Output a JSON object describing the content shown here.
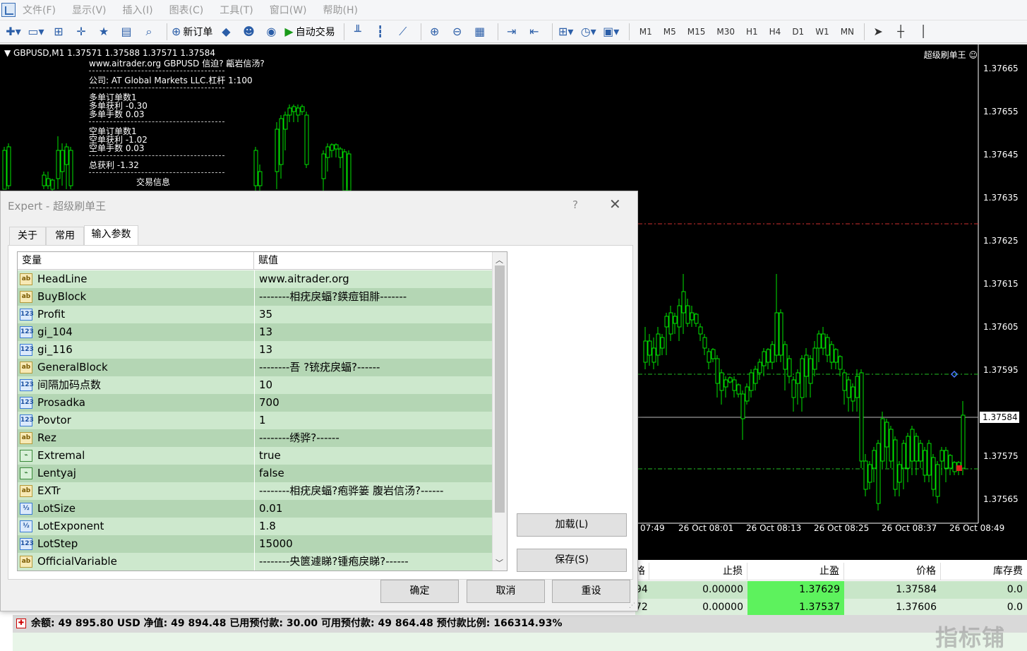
{
  "menu": [
    "文件(F)",
    "显示(V)",
    "插入(I)",
    "图表(C)",
    "工具(T)",
    "窗口(W)",
    "帮助(H)"
  ],
  "toolbar": {
    "new_order": "新订单",
    "auto_trade": "自动交易",
    "timeframes": [
      "M1",
      "M5",
      "M15",
      "M30",
      "H1",
      "H4",
      "D1",
      "W1",
      "MN"
    ]
  },
  "chart": {
    "header": "GBPUSD,M1  1.37571 1.37588 1.37571 1.37584",
    "ea_name": "超级刷单王 ☺",
    "info": {
      "site": "www.aitrader.org GBPUSD   信迫?  甂岩信汤?",
      "company": "公司: AT Global Markets LLC.杠杆 1:100",
      "buy_count": "多单订单数1",
      "buy_profit": "多单获利 -0.30",
      "buy_lots": "多单手数 0.03",
      "sell_count": "空单订单数1",
      "sell_profit": "空单获利 -1.02",
      "sell_lots": "空单手数 0.03",
      "total": "总获利 -1.32",
      "footer": "交易信息"
    },
    "prices": [
      "1.37665",
      "1.37655",
      "1.37645",
      "1.37635",
      "1.37625",
      "1.37615",
      "1.37605",
      "1.37595",
      "1.37585",
      "1.37575",
      "1.37565"
    ],
    "current_price": "1.37584",
    "times": [
      "07:49",
      "26 Oct 08:01",
      "26 Oct 08:13",
      "26 Oct 08:25",
      "26 Oct 08:37",
      "26 Oct 08:49"
    ]
  },
  "dialog": {
    "title": "Expert - 超级刷单王",
    "help": "?",
    "tabs": [
      "关于",
      "常用",
      "输入参数"
    ],
    "col_var": "变量",
    "col_val": "赋值",
    "rows": [
      {
        "type": "ab",
        "name": "HeadLine",
        "value": "www.aitrader.org"
      },
      {
        "type": "ab",
        "name": "BuyBlock",
        "value": "--------相疣戾蝠?鍈痘钼腓-------"
      },
      {
        "type": "123",
        "name": "Profit",
        "value": "35"
      },
      {
        "type": "123",
        "name": "gi_104",
        "value": "13"
      },
      {
        "type": "123",
        "name": "gi_116",
        "value": "13"
      },
      {
        "type": "ab",
        "name": "GeneralBlock",
        "value": "--------吾    ?铳疣戾蝠?------"
      },
      {
        "type": "123",
        "name": "间隔加码点数",
        "value": "10"
      },
      {
        "type": "123",
        "name": "Prosadka",
        "value": "700"
      },
      {
        "type": "123",
        "name": "Povtor",
        "value": "1"
      },
      {
        "type": "ab",
        "name": "Rez",
        "value": "--------绣骅?------"
      },
      {
        "type": "bool",
        "name": "Extremal",
        "value": "true"
      },
      {
        "type": "bool",
        "name": "Lentyaj",
        "value": "false"
      },
      {
        "type": "ab",
        "name": "EXTr",
        "value": "--------相疣戾蝠?疱骅篓 腹岩信汤?------"
      },
      {
        "type": "v2",
        "name": "LotSize",
        "value": "0.01"
      },
      {
        "type": "v2",
        "name": "LotExponent",
        "value": "1.8"
      },
      {
        "type": "123",
        "name": "LotStep",
        "value": "15000"
      },
      {
        "type": "ab",
        "name": "OfficialVariable",
        "value": "--------央篋遽睇?锺疱戾睇?------"
      }
    ],
    "load": "加载(L)",
    "save": "保存(S)",
    "ok": "确定",
    "cancel": "取消",
    "reset": "重设"
  },
  "terminal": {
    "headers": [
      "格",
      "止损",
      "止盈",
      "价格",
      "库存费"
    ],
    "rows": [
      {
        "price_frag": "94",
        "sl": "0.00000",
        "tp": "1.37629",
        "price": "1.37584",
        "swap": "0.0"
      },
      {
        "price_frag": "72",
        "sl": "0.00000",
        "tp": "1.37537",
        "price": "1.37606",
        "swap": "0.0"
      }
    ],
    "balance": "余额: 49 895.80 USD  净值: 49 894.48  已用预付款: 30.00  可用预付款: 49 864.48  预付款比例: 166314.93%"
  },
  "watermark": "指标铺",
  "colors": {
    "bull": "#00e400",
    "chart_bg": "#000000",
    "grid_row_a": "#c8e6c8",
    "grid_row_b": "#a8cfa8",
    "tp_green": "#5df25d"
  }
}
